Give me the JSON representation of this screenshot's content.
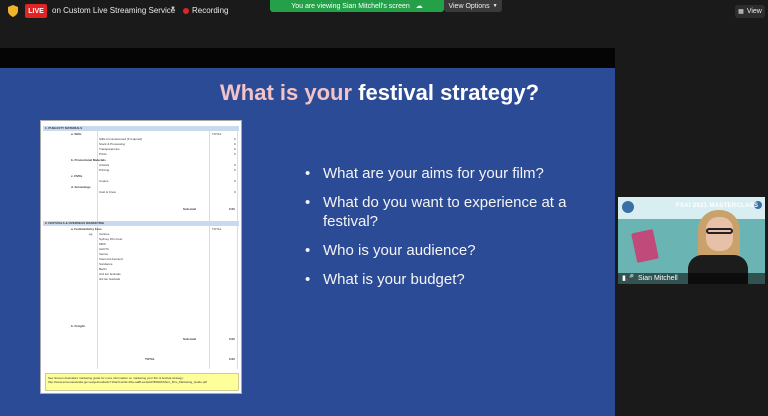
{
  "toolbar": {
    "live_badge": "LIVE",
    "stream_service": "on Custom Live Streaming Service",
    "recording": "Recording",
    "viewing_banner": "You are viewing Sian Mitchell's screen",
    "view_options": "View Options",
    "view": "View"
  },
  "slide": {
    "title_part1": "What is your",
    "title_part2": "festival strategy?",
    "bullets": [
      "What are your aims for your film?",
      "What do you want to experience at a festival?",
      "Who is your audience?",
      "What is your budget?"
    ]
  },
  "spreadsheet": {
    "section1": "1. PUBLICITY MATERIALS",
    "total_label": "TOTAL",
    "stills": "a. Stills",
    "stills_items": [
      "Stills Commissioned (if required)",
      "Stock & Processing",
      "Transparencies",
      "Prints"
    ],
    "promo": "b. Promotional Materials",
    "promo_items": [
      "Artwork",
      "Printing"
    ],
    "dvds": "c. DVDs",
    "dvd_items": [
      "Copies"
    ],
    "screenings": "d. Screenings",
    "screening_items": [
      "Cast & Crew"
    ],
    "subtotal": "Sub-total",
    "subtotal_value": "0.00",
    "zero": "0",
    "section2": "2. FESTIVALS & OVERSEAS MARKETING",
    "festival_entry": "a. Festival Entry Fees",
    "eg": "eg.",
    "festival_items": [
      "Cannes",
      "Sydney Film Fest",
      "MIFF",
      "AACTA",
      "Venice",
      "Clermont-Ferrand",
      "Sundance",
      "Berlin",
      "2nd tier festivals",
      "3rd tier festivals"
    ],
    "freight": "b. Freight",
    "total": "TOTAL",
    "total_value": "0.00",
    "note": "See Screen Australia's marketing guide for more information on marketing your film & festival strategy: http://www.screenaustralia.gov.au/getmedia/4c719ac3-eb3d-4f1e-aa8f-ee3e0d7869d9/Short_Film_Marketing_Guide.pdf"
  },
  "participant": {
    "banner": "FSAI 2021 MASTERCLASS",
    "name": "Sian Mitchell"
  },
  "colors": {
    "slide_bg": "#2c4b96",
    "title_pink": "#f3c3c8",
    "live_red": "#e02424",
    "banner_green": "#24a148"
  }
}
